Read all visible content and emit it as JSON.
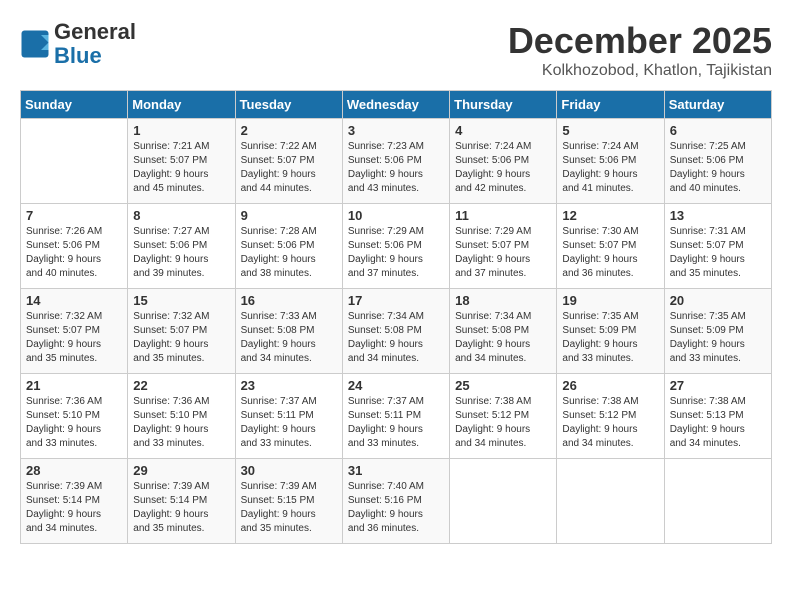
{
  "header": {
    "logo_line1": "General",
    "logo_line2": "Blue",
    "month": "December 2025",
    "location": "Kolkhozobod, Khatlon, Tajikistan"
  },
  "weekdays": [
    "Sunday",
    "Monday",
    "Tuesday",
    "Wednesday",
    "Thursday",
    "Friday",
    "Saturday"
  ],
  "weeks": [
    [
      {
        "day": "",
        "info": ""
      },
      {
        "day": "1",
        "info": "Sunrise: 7:21 AM\nSunset: 5:07 PM\nDaylight: 9 hours\nand 45 minutes."
      },
      {
        "day": "2",
        "info": "Sunrise: 7:22 AM\nSunset: 5:07 PM\nDaylight: 9 hours\nand 44 minutes."
      },
      {
        "day": "3",
        "info": "Sunrise: 7:23 AM\nSunset: 5:06 PM\nDaylight: 9 hours\nand 43 minutes."
      },
      {
        "day": "4",
        "info": "Sunrise: 7:24 AM\nSunset: 5:06 PM\nDaylight: 9 hours\nand 42 minutes."
      },
      {
        "day": "5",
        "info": "Sunrise: 7:24 AM\nSunset: 5:06 PM\nDaylight: 9 hours\nand 41 minutes."
      },
      {
        "day": "6",
        "info": "Sunrise: 7:25 AM\nSunset: 5:06 PM\nDaylight: 9 hours\nand 40 minutes."
      }
    ],
    [
      {
        "day": "7",
        "info": "Sunrise: 7:26 AM\nSunset: 5:06 PM\nDaylight: 9 hours\nand 40 minutes."
      },
      {
        "day": "8",
        "info": "Sunrise: 7:27 AM\nSunset: 5:06 PM\nDaylight: 9 hours\nand 39 minutes."
      },
      {
        "day": "9",
        "info": "Sunrise: 7:28 AM\nSunset: 5:06 PM\nDaylight: 9 hours\nand 38 minutes."
      },
      {
        "day": "10",
        "info": "Sunrise: 7:29 AM\nSunset: 5:06 PM\nDaylight: 9 hours\nand 37 minutes."
      },
      {
        "day": "11",
        "info": "Sunrise: 7:29 AM\nSunset: 5:07 PM\nDaylight: 9 hours\nand 37 minutes."
      },
      {
        "day": "12",
        "info": "Sunrise: 7:30 AM\nSunset: 5:07 PM\nDaylight: 9 hours\nand 36 minutes."
      },
      {
        "day": "13",
        "info": "Sunrise: 7:31 AM\nSunset: 5:07 PM\nDaylight: 9 hours\nand 35 minutes."
      }
    ],
    [
      {
        "day": "14",
        "info": "Sunrise: 7:32 AM\nSunset: 5:07 PM\nDaylight: 9 hours\nand 35 minutes."
      },
      {
        "day": "15",
        "info": "Sunrise: 7:32 AM\nSunset: 5:07 PM\nDaylight: 9 hours\nand 35 minutes."
      },
      {
        "day": "16",
        "info": "Sunrise: 7:33 AM\nSunset: 5:08 PM\nDaylight: 9 hours\nand 34 minutes."
      },
      {
        "day": "17",
        "info": "Sunrise: 7:34 AM\nSunset: 5:08 PM\nDaylight: 9 hours\nand 34 minutes."
      },
      {
        "day": "18",
        "info": "Sunrise: 7:34 AM\nSunset: 5:08 PM\nDaylight: 9 hours\nand 34 minutes."
      },
      {
        "day": "19",
        "info": "Sunrise: 7:35 AM\nSunset: 5:09 PM\nDaylight: 9 hours\nand 33 minutes."
      },
      {
        "day": "20",
        "info": "Sunrise: 7:35 AM\nSunset: 5:09 PM\nDaylight: 9 hours\nand 33 minutes."
      }
    ],
    [
      {
        "day": "21",
        "info": "Sunrise: 7:36 AM\nSunset: 5:10 PM\nDaylight: 9 hours\nand 33 minutes."
      },
      {
        "day": "22",
        "info": "Sunrise: 7:36 AM\nSunset: 5:10 PM\nDaylight: 9 hours\nand 33 minutes."
      },
      {
        "day": "23",
        "info": "Sunrise: 7:37 AM\nSunset: 5:11 PM\nDaylight: 9 hours\nand 33 minutes."
      },
      {
        "day": "24",
        "info": "Sunrise: 7:37 AM\nSunset: 5:11 PM\nDaylight: 9 hours\nand 33 minutes."
      },
      {
        "day": "25",
        "info": "Sunrise: 7:38 AM\nSunset: 5:12 PM\nDaylight: 9 hours\nand 34 minutes."
      },
      {
        "day": "26",
        "info": "Sunrise: 7:38 AM\nSunset: 5:12 PM\nDaylight: 9 hours\nand 34 minutes."
      },
      {
        "day": "27",
        "info": "Sunrise: 7:38 AM\nSunset: 5:13 PM\nDaylight: 9 hours\nand 34 minutes."
      }
    ],
    [
      {
        "day": "28",
        "info": "Sunrise: 7:39 AM\nSunset: 5:14 PM\nDaylight: 9 hours\nand 34 minutes."
      },
      {
        "day": "29",
        "info": "Sunrise: 7:39 AM\nSunset: 5:14 PM\nDaylight: 9 hours\nand 35 minutes."
      },
      {
        "day": "30",
        "info": "Sunrise: 7:39 AM\nSunset: 5:15 PM\nDaylight: 9 hours\nand 35 minutes."
      },
      {
        "day": "31",
        "info": "Sunrise: 7:40 AM\nSunset: 5:16 PM\nDaylight: 9 hours\nand 36 minutes."
      },
      {
        "day": "",
        "info": ""
      },
      {
        "day": "",
        "info": ""
      },
      {
        "day": "",
        "info": ""
      }
    ]
  ]
}
